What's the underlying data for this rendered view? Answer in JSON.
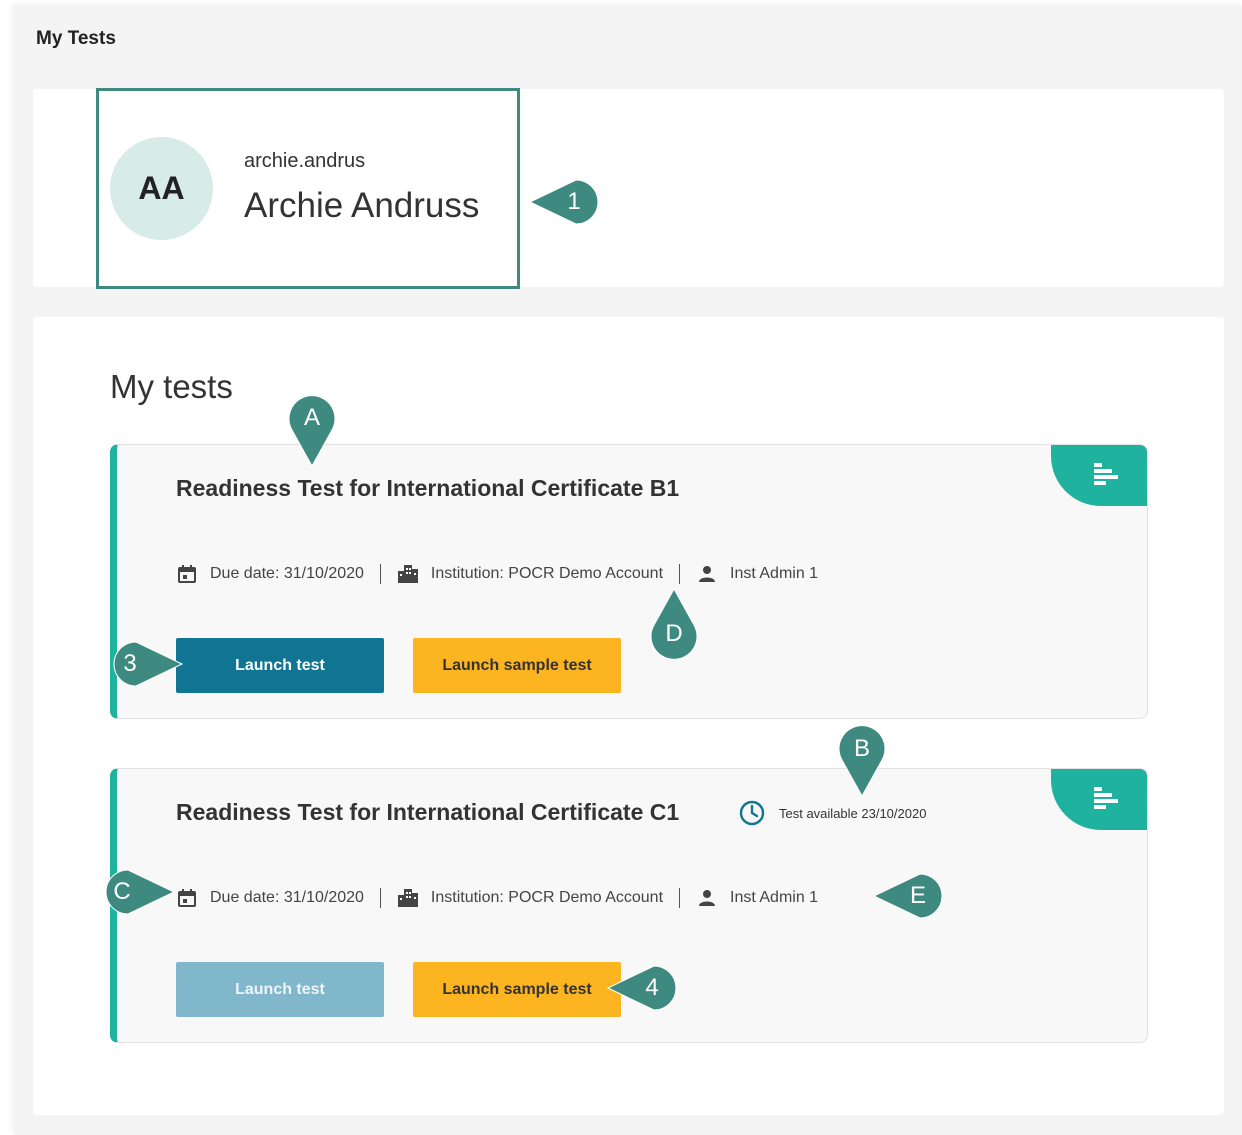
{
  "page": {
    "title": "My Tests"
  },
  "profile": {
    "initials": "AA",
    "username": "archie.andrus",
    "full_name": "Archie Andruss"
  },
  "tests_section": {
    "title": "My tests"
  },
  "tests": [
    {
      "title": "Readiness Test for International Certificate B1",
      "due_date": "Due date: 31/10/2020",
      "institution": "Institution: POCR Demo Account",
      "admin": "Inst Admin 1",
      "launch_label": "Launch test",
      "launch_enabled": true,
      "sample_label": "Launch sample test",
      "availability": ""
    },
    {
      "title": "Readiness Test for International Certificate C1",
      "due_date": "Due date: 31/10/2020",
      "institution": "Institution: POCR Demo Account",
      "admin": "Inst Admin 1",
      "launch_label": "Launch test",
      "launch_enabled": false,
      "sample_label": "Launch sample test",
      "availability": "Test available 23/10/2020"
    }
  ],
  "callouts": {
    "c1": "1",
    "c3": "3",
    "c4": "4",
    "cA": "A",
    "cB": "B",
    "cC": "C",
    "cD": "D",
    "cE": "E"
  },
  "colors": {
    "accent": "#1fb39f",
    "primary_button": "#0f7592",
    "primary_button_disabled": "#80b7ca",
    "secondary_button": "#fcb420",
    "callout": "#3f8a80"
  },
  "icons": {
    "calendar": "calendar-icon",
    "institution": "building-icon",
    "admin": "person-icon",
    "clock": "clock-icon",
    "card_tab": "bars-icon"
  }
}
